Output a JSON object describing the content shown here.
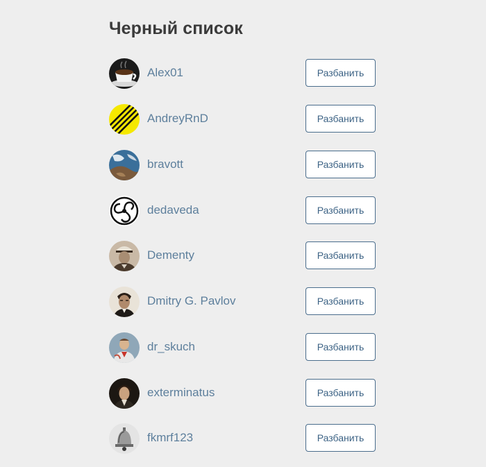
{
  "page": {
    "title": "Черный список",
    "unban_label": "Разбанить"
  },
  "users": [
    {
      "name": "Alex01",
      "avatar": "coffee-cup-avatar"
    },
    {
      "name": "AndreyRnD",
      "avatar": "yellow-striped-avatar"
    },
    {
      "name": "bravott",
      "avatar": "earth-from-space-avatar"
    },
    {
      "name": "dedaveda",
      "avatar": "triskelion-avatar"
    },
    {
      "name": "Dementy",
      "avatar": "old-portrait-avatar"
    },
    {
      "name": "Dmitry G. Pavlov",
      "avatar": "man-portrait-avatar"
    },
    {
      "name": "dr_skuch",
      "avatar": "painted-figure-avatar"
    },
    {
      "name": "exterminatus",
      "avatar": "classic-portrait-avatar"
    },
    {
      "name": "fkmrf123",
      "avatar": "bell-sketch-avatar"
    }
  ]
}
